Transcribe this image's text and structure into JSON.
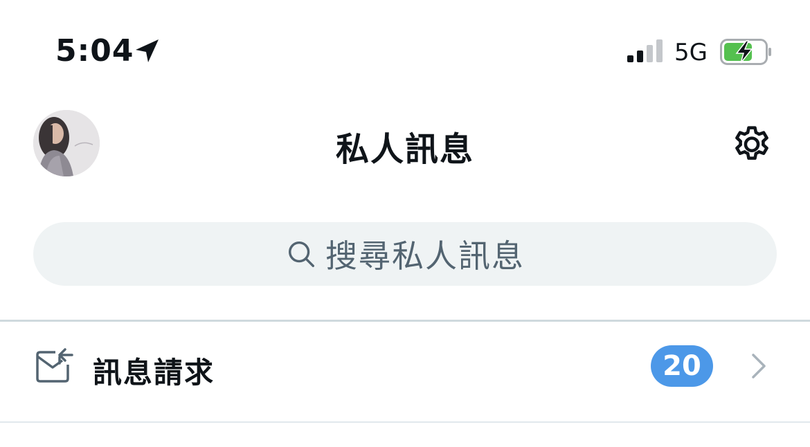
{
  "status_bar": {
    "time": "5:04",
    "network": "5G",
    "icons": [
      "location-arrow-icon",
      "cellular-signal-icon",
      "battery-charging-icon"
    ],
    "battery_color": "#54c04f"
  },
  "header": {
    "title": "私人訊息",
    "avatar_icon": "profile-avatar",
    "settings_icon": "gear-icon"
  },
  "search": {
    "placeholder": "搜尋私人訊息",
    "icon": "search-icon"
  },
  "message_requests": {
    "label": "訊息請求",
    "count": "20",
    "icon": "mail-return-icon",
    "chevron": "chevron-right-icon",
    "badge_color": "#4c98e8"
  }
}
